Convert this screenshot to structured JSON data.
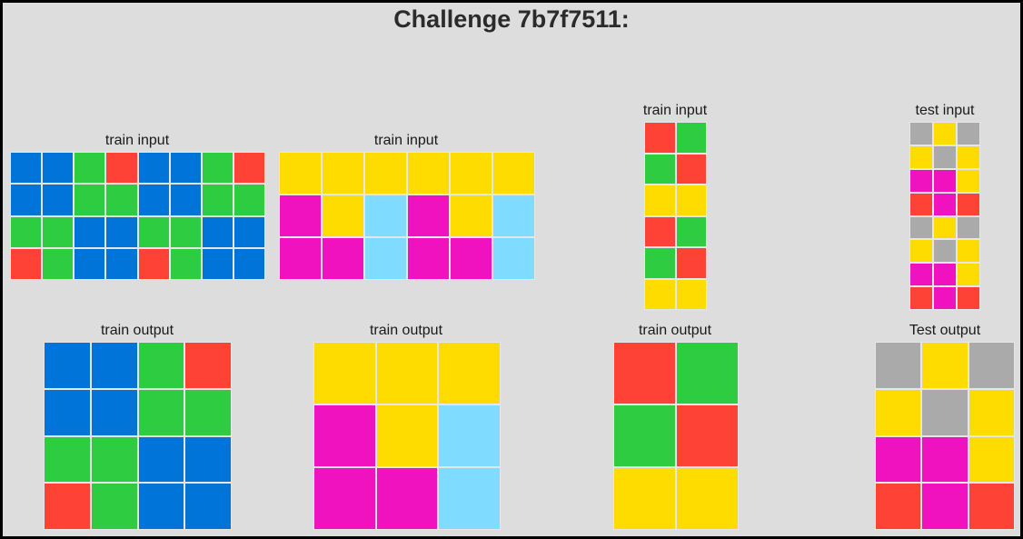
{
  "title": "Challenge 7b7f7511:",
  "colors": {
    "0": "#000000",
    "1": "#0074d9",
    "2": "#ff4136",
    "3": "#2ecc40",
    "4": "#ffdc00",
    "5": "#aaaaaa",
    "6": "#f012be",
    "7": "#ff851b",
    "8": "#7fdbff",
    "9": "#870c25"
  },
  "panels": [
    {
      "label": "train input",
      "grid": [
        [
          1,
          1,
          3,
          2,
          1,
          1,
          3,
          2
        ],
        [
          1,
          1,
          3,
          3,
          1,
          1,
          3,
          3
        ],
        [
          3,
          3,
          1,
          1,
          3,
          3,
          1,
          1
        ],
        [
          2,
          3,
          1,
          1,
          2,
          3,
          1,
          1
        ]
      ]
    },
    {
      "label": "train input",
      "grid": [
        [
          4,
          4,
          4,
          4,
          4,
          4
        ],
        [
          6,
          4,
          8,
          6,
          4,
          8
        ],
        [
          6,
          6,
          8,
          6,
          6,
          8
        ]
      ]
    },
    {
      "label": "train input",
      "grid": [
        [
          2,
          3
        ],
        [
          3,
          2
        ],
        [
          4,
          4
        ],
        [
          2,
          3
        ],
        [
          3,
          2
        ],
        [
          4,
          4
        ]
      ]
    },
    {
      "label": "test input",
      "grid": [
        [
          5,
          4,
          5
        ],
        [
          4,
          5,
          4
        ],
        [
          6,
          6,
          4
        ],
        [
          2,
          6,
          2
        ],
        [
          5,
          4,
          5
        ],
        [
          4,
          5,
          4
        ],
        [
          6,
          6,
          4
        ],
        [
          2,
          6,
          2
        ]
      ]
    },
    {
      "label": "train output",
      "grid": [
        [
          1,
          1,
          3,
          2
        ],
        [
          1,
          1,
          3,
          3
        ],
        [
          3,
          3,
          1,
          1
        ],
        [
          2,
          3,
          1,
          1
        ]
      ]
    },
    {
      "label": "train output",
      "grid": [
        [
          4,
          4,
          4
        ],
        [
          6,
          4,
          8
        ],
        [
          6,
          6,
          8
        ]
      ]
    },
    {
      "label": "train output",
      "grid": [
        [
          2,
          3
        ],
        [
          3,
          2
        ],
        [
          4,
          4
        ]
      ]
    },
    {
      "label": "Test output",
      "grid": [
        [
          5,
          4,
          5
        ],
        [
          4,
          5,
          4
        ],
        [
          6,
          6,
          4
        ],
        [
          2,
          6,
          2
        ]
      ]
    }
  ]
}
